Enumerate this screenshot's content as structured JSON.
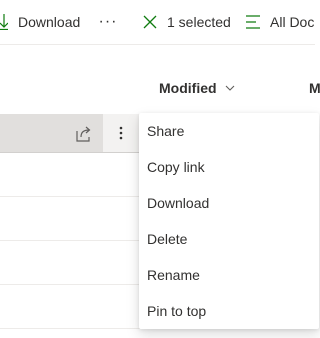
{
  "toolbar": {
    "download_label": "Download",
    "more_glyph": "···",
    "selected_label": "1 selected",
    "view_label": "All Doc",
    "icons": [
      "download-icon",
      "ellipsis-icon",
      "close-icon",
      "list-view-icon"
    ]
  },
  "columns": {
    "modified_label": "Modified",
    "next_label": "M"
  },
  "context_menu": {
    "items": [
      "Share",
      "Copy link",
      "Download",
      "Delete",
      "Rename",
      "Pin to top"
    ]
  },
  "colors": {
    "accent_green": "#107c10",
    "text": "#323130",
    "selected_row": "#e1dfdd",
    "divider": "#edebe9"
  }
}
